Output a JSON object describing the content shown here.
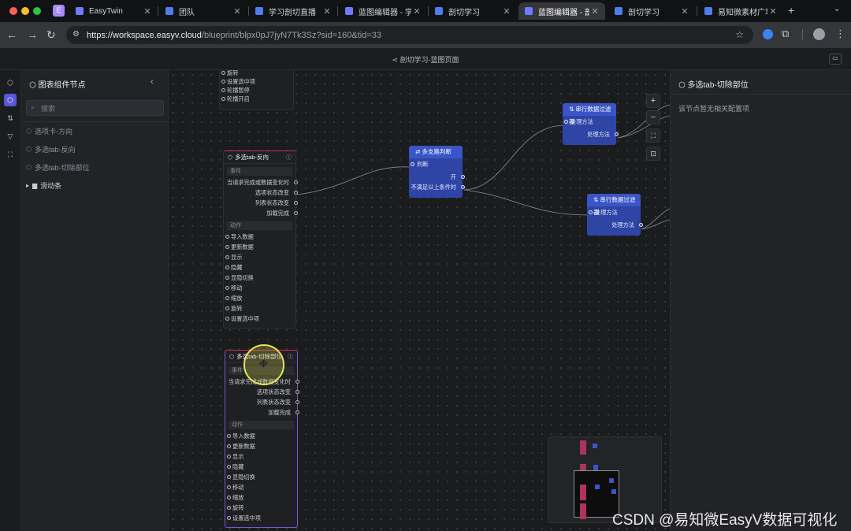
{
  "browser": {
    "tabs": [
      {
        "title": "EasyTwin",
        "icon": "cube-icon",
        "active": false
      },
      {
        "title": "团队",
        "icon": "doc-icon",
        "active": false
      },
      {
        "title": "学习剖切直播",
        "icon": "doc-icon",
        "active": false
      },
      {
        "title": "蓝图编辑器 - 学",
        "icon": "cube-icon",
        "active": false
      },
      {
        "title": "剖切学习",
        "icon": "doc-icon",
        "active": false
      },
      {
        "title": "蓝图编辑器 - 剖",
        "icon": "cube-icon",
        "active": true
      },
      {
        "title": "剖切学习",
        "icon": "doc-icon",
        "active": false
      },
      {
        "title": "易知微素材广场",
        "icon": "doc-icon",
        "active": false
      }
    ],
    "url_host": "https://workspace.easyv.cloud",
    "url_path": "/blueprint/blpx0pJ7jyN7Tk3Sz?sid=160&tid=33",
    "profile_letter": "E"
  },
  "app": {
    "title": "剖切学习-蓝图页面"
  },
  "left_panel": {
    "title": "图表组件节点",
    "search_placeholder": "搜索",
    "items": [
      {
        "label": "选项卡-方向"
      },
      {
        "label": "多选tab-反向"
      },
      {
        "label": "多选tab-切除部位"
      }
    ],
    "folder": {
      "label": "滑动条"
    }
  },
  "right_panel": {
    "title": "多选tab-切除部位",
    "note": "该节点暂无相关配置项"
  },
  "nodes": {
    "top_partial": {
      "rows": [
        "旋转",
        "设置选中项",
        "轮播暂停",
        "轮播开启"
      ]
    },
    "reverse": {
      "title": "多选tab-反向",
      "events_label": "事件",
      "events": [
        "当请求完成或数据变化时",
        "选项状态改变",
        "列表状态改变",
        "加载完成"
      ],
      "actions_label": "动作",
      "actions": [
        "导入数据",
        "更新数据",
        "显示",
        "隐藏",
        "显隐切换",
        "移动",
        "缩放",
        "旋转",
        "设置选中项"
      ]
    },
    "cut": {
      "title": "多选tab-切除部位",
      "events_label": "事件",
      "events": [
        "当请求完成或数据变化时",
        "选项状态改变",
        "列表状态改变",
        "加载完成"
      ],
      "actions_label": "动作",
      "actions": [
        "导入数据",
        "更新数据",
        "显示",
        "隐藏",
        "显隐切换",
        "移动",
        "缩放",
        "旋转",
        "设置选中项"
      ]
    },
    "branch": {
      "title": "多支路判断",
      "input": "判断",
      "outputs": [
        "开",
        "不满足以上条件时"
      ]
    },
    "filter1": {
      "title": "串行数据过滤器",
      "input": "处理方法",
      "output": "处理方法"
    },
    "filter2": {
      "title": "串行数据过滤器",
      "input": "处理方法",
      "output": "处理方法"
    }
  },
  "canvas_controls": {
    "zoom_in": "+",
    "zoom_out": "−"
  },
  "watermark": "CSDN @易知微EasyV数据可视化",
  "colors": {
    "accent": "#5b56d6",
    "blue_node": "#3a55c7",
    "selected_border": "#7e55d6"
  }
}
